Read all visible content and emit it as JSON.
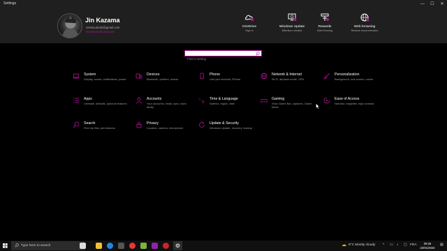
{
  "window": {
    "title": "Settings",
    "minimize": "—",
    "maximize": "☐",
    "close": "✕"
  },
  "user": {
    "name": "Jin Kazama",
    "email": "zelekoud192@gmail.com",
    "link": "My Microsoft account"
  },
  "quick_actions": [
    {
      "title": "OneDrive",
      "subtitle": "Sign in",
      "icon": "onedrive-icon"
    },
    {
      "title": "Windows Update",
      "subtitle": "Attention needed",
      "icon": "windows-update-icon"
    },
    {
      "title": "Rewards",
      "subtitle": "Start Earning",
      "icon": "rewards-icon"
    },
    {
      "title": "Web browsing",
      "subtitle": "Restore recommended",
      "icon": "web-browsing-icon"
    }
  ],
  "search": {
    "placeholder": "Find a setting"
  },
  "categories": [
    {
      "title": "System",
      "desc": "Display, sound, notifications, power",
      "icon": "laptop-icon"
    },
    {
      "title": "Devices",
      "desc": "Bluetooth, printers, mouse",
      "icon": "devices-icon"
    },
    {
      "title": "Phone",
      "desc": "Link your Android, iPhone",
      "icon": "phone-icon"
    },
    {
      "title": "Network & Internet",
      "desc": "Wi-Fi, airplane mode, VPN",
      "icon": "globe-icon"
    },
    {
      "title": "Personalization",
      "desc": "Background, lock screen, colors",
      "icon": "brush-icon"
    },
    {
      "title": "Apps",
      "desc": "Uninstall, defaults, optional features",
      "icon": "apps-icon"
    },
    {
      "title": "Accounts",
      "desc": "Your accounts, email, sync, work, family",
      "icon": "person-icon"
    },
    {
      "title": "Time & Language",
      "desc": "Speech, region, date",
      "icon": "time-language-icon"
    },
    {
      "title": "Gaming",
      "desc": "Xbox Game Bar, captures, Game Mode",
      "icon": "gamepad-icon"
    },
    {
      "title": "Ease of Access",
      "desc": "Narrator, magnifier, high contrast",
      "icon": "ease-of-access-icon"
    },
    {
      "title": "Search",
      "desc": "Find my files, permissions",
      "icon": "search-icon"
    },
    {
      "title": "Privacy",
      "desc": "Location, camera, microphone",
      "icon": "lock-icon"
    },
    {
      "title": "Update & Security",
      "desc": "Windows Update, recovery, backup",
      "icon": "update-icon"
    }
  ],
  "taskbar": {
    "search_placeholder": "Type here to search",
    "weather": "8°C  Mostly cloudy",
    "language": "FRA",
    "time": "09:26",
    "date": "22/01/2023"
  },
  "colors": {
    "accent": "#b3139b",
    "background": "#000000",
    "header": "#1f1f1f"
  }
}
